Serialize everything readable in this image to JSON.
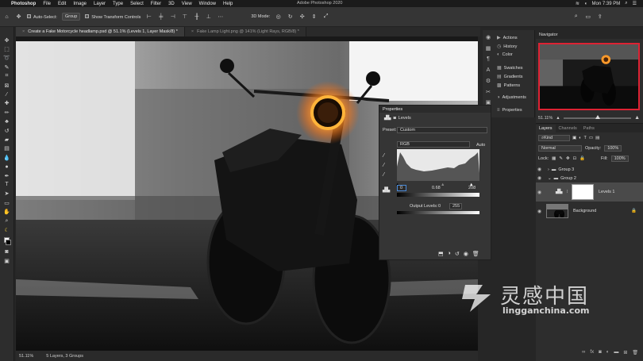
{
  "menubar": {
    "apple": "",
    "items": [
      "Photoshop",
      "File",
      "Edit",
      "Image",
      "Layer",
      "Type",
      "Select",
      "Filter",
      "3D",
      "View",
      "Window",
      "Help"
    ],
    "window_title": "Adobe Photoshop 2020",
    "clock": "Mon 7:39 PM"
  },
  "options": {
    "auto_select_label": "Auto-Select:",
    "auto_select_value": "Group",
    "show_transform_label": "Show Transform Controls",
    "mode_3d": "3D Mode:"
  },
  "tabs": [
    {
      "label": "Create a Fake Motorcycle headlamp.psd @ 51.1% (Levels 1, Layer Mask/8) *",
      "active": true
    },
    {
      "label": "Fake Lamp Light.png @ 141% (Light Rays, RGB/8) *",
      "active": false
    }
  ],
  "status": {
    "zoom": "51.11%",
    "info": "5 Layers, 3 Groups"
  },
  "dock": {
    "items": [
      "Actions",
      "History",
      "Color",
      "Swatches",
      "Gradients",
      "Patterns",
      "Adjustments",
      "Properties"
    ]
  },
  "properties": {
    "title": "Properties",
    "adjustment": "Levels",
    "preset_label": "Preset:",
    "preset_value": "Custom",
    "channel": "RGB",
    "auto_label": "Auto",
    "input_black": "0",
    "input_mid": "0.68",
    "input_white": "208",
    "output_label": "Output Levels:",
    "output_black": "0",
    "output_white": "255"
  },
  "navigator": {
    "title": "Navigator",
    "zoom": "51.11%"
  },
  "layers": {
    "tabs": [
      "Layers",
      "Channels",
      "Paths"
    ],
    "filter_kind": "Kind",
    "blend_mode": "Normal",
    "opacity_label": "Opacity:",
    "opacity_value": "100%",
    "lock_label": "Lock:",
    "fill_label": "Fill:",
    "fill_value": "100%",
    "items": [
      {
        "name": "Group 3",
        "type": "group"
      },
      {
        "name": "Group 2",
        "type": "group"
      },
      {
        "name": "Levels 1",
        "type": "adjustment"
      },
      {
        "name": "Background",
        "type": "pixel"
      }
    ]
  },
  "watermark": {
    "cn": "灵感中国",
    "en": "lingganchina.com"
  }
}
